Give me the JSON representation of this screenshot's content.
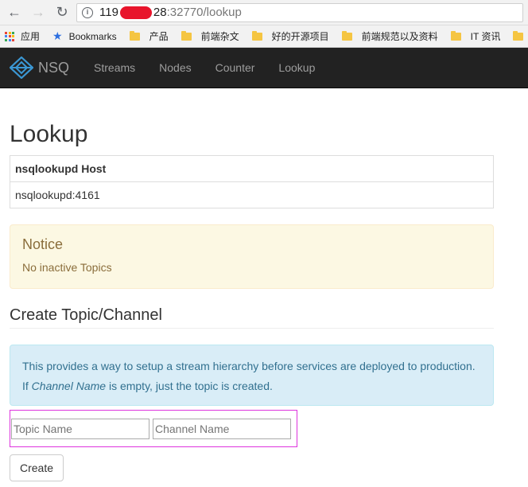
{
  "browser": {
    "url_host_start": "119",
    "url_host_end": "28",
    "url_path": ":32770/lookup",
    "bookmarks": [
      {
        "label": "应用",
        "icon": "apps-icon"
      },
      {
        "label": "Bookmarks",
        "icon": "star-icon"
      },
      {
        "label": "产品",
        "icon": "folder-icon"
      },
      {
        "label": "前端杂文",
        "icon": "folder-icon"
      },
      {
        "label": "好的开源项目",
        "icon": "folder-icon"
      },
      {
        "label": "前端规范以及资料",
        "icon": "folder-icon"
      },
      {
        "label": "IT 资讯",
        "icon": "folder-icon"
      }
    ]
  },
  "navbar": {
    "brand": "NSQ",
    "links": [
      "Streams",
      "Nodes",
      "Counter",
      "Lookup"
    ]
  },
  "page": {
    "title": "Lookup",
    "table_header": "nsqlookupd Host",
    "table_rows": [
      "nsqlookupd:4161"
    ],
    "notice_title": "Notice",
    "notice_text": "No inactive Topics",
    "create_heading": "Create Topic/Channel",
    "info_line1": "This provides a way to setup a stream hierarchy before services are deployed to production.",
    "info_line2_pre": "If ",
    "info_line2_em": "Channel Name",
    "info_line2_post": " is empty, just the topic is created.",
    "topic_placeholder": "Topic Name",
    "channel_placeholder": "Channel Name",
    "create_label": "Create"
  },
  "colors": {
    "navbar_bg": "#222222",
    "notice_bg": "#fcf8e3",
    "info_bg": "#d9edf7",
    "form_outline": "#dd33dd"
  }
}
